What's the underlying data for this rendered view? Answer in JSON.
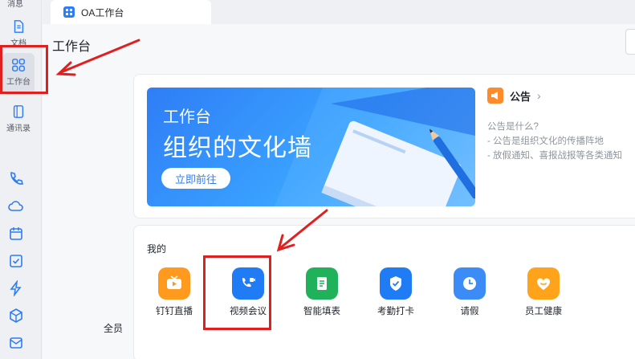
{
  "rail": {
    "top_cut_label": "消息",
    "items": [
      {
        "label": "文档",
        "icon": "doc-icon"
      },
      {
        "label": "工作台",
        "icon": "grid-icon"
      },
      {
        "label": "通讯录",
        "icon": "contacts-icon"
      }
    ],
    "more_icons": [
      "phone-icon",
      "cloud-icon",
      "calendar-icon",
      "todo-icon",
      "bolt-icon",
      "cube-icon",
      "mail-icon"
    ]
  },
  "tab": {
    "title": "OA工作台"
  },
  "page": {
    "title": "工作台"
  },
  "banner": {
    "sub": "工作台",
    "title": "组织的文化墙",
    "button": "立即前往"
  },
  "notice": {
    "title": "公告",
    "lines": [
      "公告是什么?",
      "- 公告是组织文化的传播阵地",
      "- 放假通知、喜报战报等各类通知"
    ]
  },
  "mine": {
    "title": "我的",
    "apps": [
      {
        "label": "钉钉直播",
        "icon": "live-icon",
        "color": "#ff9a1f"
      },
      {
        "label": "视频会议",
        "icon": "video-meeting-icon",
        "color": "#1f7cf5"
      },
      {
        "label": "智能填表",
        "icon": "form-icon",
        "color": "#1fb25a"
      },
      {
        "label": "考勤打卡",
        "icon": "checkin-icon",
        "color": "#1f7cf5"
      },
      {
        "label": "请假",
        "icon": "leave-icon",
        "color": "#3b8cf6"
      },
      {
        "label": "员工健康",
        "icon": "health-icon",
        "color": "#ffa31a"
      }
    ]
  },
  "all": {
    "title": "全员"
  },
  "colors": {
    "accent": "#2f7df6",
    "annotation": "#e02020"
  }
}
